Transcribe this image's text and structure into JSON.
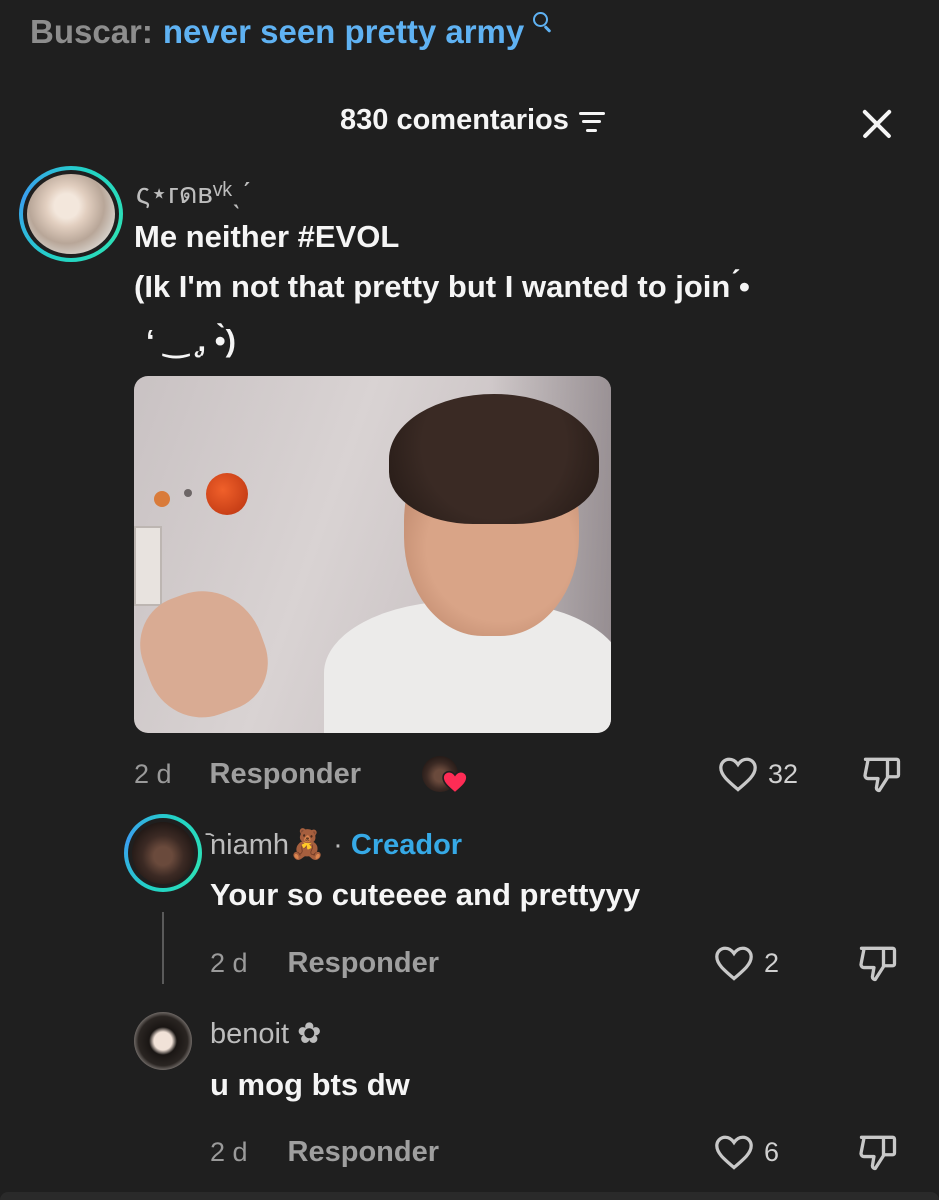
{
  "search": {
    "prefix": "Buscar:",
    "query": "never seen pretty army",
    "icon": "search-icon"
  },
  "header": {
    "comment_count": "830 comentarios",
    "sort_icon": "sort-icon",
    "close_icon": "close-icon"
  },
  "comments": [
    {
      "username": "ς⋆гดʙᵛᵏˎˊ",
      "text_line1": "Me neither #EVOL",
      "text_line2": "(Ik I'm not that pretty but I wanted to join ́•",
      "text_line3": "‘ ‿ ̨, •̀)",
      "has_photo": true,
      "timestamp": "2 d",
      "reply_label": "Responder",
      "creator_liked": true,
      "likes": "32"
    },
    {
      "username": "᷆niamh🧸",
      "badge_separator": "·",
      "badge": "Creador",
      "text": "Your so cuteeee and prettyyy",
      "timestamp": "2 d",
      "reply_label": "Responder",
      "likes": "2"
    },
    {
      "username": "benoit ✿",
      "text": "u mog bts dw",
      "timestamp": "2 d",
      "reply_label": "Responder",
      "likes": "6"
    }
  ],
  "colors": {
    "background": "#1f1f1f",
    "search_query": "#5fb2f3",
    "creator_badge": "#36a9e6",
    "avatar_ring": "#22d3c5",
    "liked_heart": "#fe2c55"
  }
}
